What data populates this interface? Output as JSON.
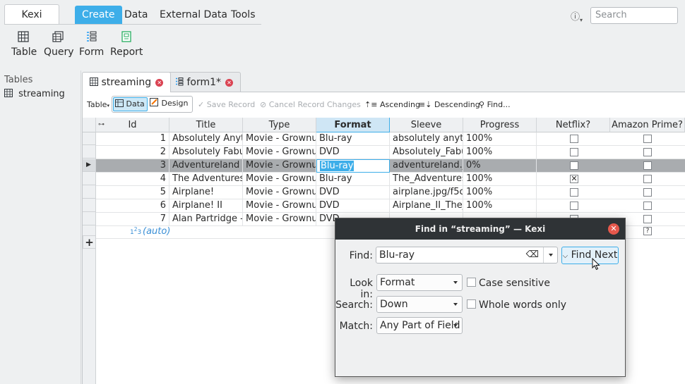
{
  "app": {
    "name": "Kexi"
  },
  "ribbon_tabs": [
    "Create",
    "Data",
    "External Data",
    "Tools"
  ],
  "info_icon": "ⓘ",
  "search": {
    "placeholder": "Search"
  },
  "ribbon_buttons": [
    "Table",
    "Query",
    "Form",
    "Report"
  ],
  "left_pane": {
    "title": "Tables",
    "items": [
      "streaming"
    ]
  },
  "doc_tabs": [
    "streaming",
    "form1*"
  ],
  "toolbar": {
    "table_label": "Table",
    "data_label": "Data",
    "design_label": "Design",
    "save_record": "Save Record",
    "cancel_changes": "Cancel Record Changes",
    "ascending": "Ascending",
    "descending": "Descending",
    "find": "Find..."
  },
  "grid": {
    "columns": [
      "Id",
      "Title",
      "Type",
      "Format",
      "Sleeve",
      "Progress",
      "Netflix?",
      "Amazon Prime?"
    ],
    "rows": [
      {
        "id": "1",
        "title": "Absolutely Anyt",
        "type": "Movie - Grownuj",
        "format": "Blu-ray",
        "sleeve": "absolutely anyth",
        "progress": "100%",
        "netflix": false
      },
      {
        "id": "2",
        "title": "Absolutely Fabu",
        "type": "Movie - Grownuj",
        "format": "DVD",
        "sleeve": "Absolutely_Fabu",
        "progress": "100%",
        "netflix": false
      },
      {
        "id": "3",
        "title": "Adventureland",
        "type": "Movie - Grownuj",
        "format": "Blu-ray",
        "sleeve": "adventureland.j",
        "progress": "0%",
        "netflix": false
      },
      {
        "id": "4",
        "title": "The Adventures",
        "type": "Movie - Grownuj",
        "format": "Blu-ray",
        "sleeve": "The_Adventures",
        "progress": "100%",
        "netflix": true
      },
      {
        "id": "5",
        "title": "Airplane!",
        "type": "Movie - Grownuj",
        "format": "DVD",
        "sleeve": "airplane.jpg/f5c",
        "progress": "100%",
        "netflix": false
      },
      {
        "id": "6",
        "title": "Airplane! II",
        "type": "Movie - Grownuj",
        "format": "DVD",
        "sleeve": "Airplane_II_The_",
        "progress": "100%",
        "netflix": false
      },
      {
        "id": "7",
        "title": "Alan Partridge -",
        "type": "Movie - Grownuj",
        "format": "DVD",
        "sleeve": "",
        "progress": "",
        "netflix": false
      }
    ],
    "new_row_id": "(auto)",
    "add_row": "+"
  },
  "dialog": {
    "title": "Find in “streaming” — Kexi",
    "find_label": "Find:",
    "find_value": "Blu-ray",
    "find_next": "Find Next",
    "look_in_label": "Look in:",
    "look_in_value": "Format",
    "case_sensitive": "Case sensitive",
    "search_label": "Search:",
    "search_value": "Down",
    "whole_words": "Whole words only",
    "match_label": "Match:",
    "match_value": "Any Part of Field"
  }
}
